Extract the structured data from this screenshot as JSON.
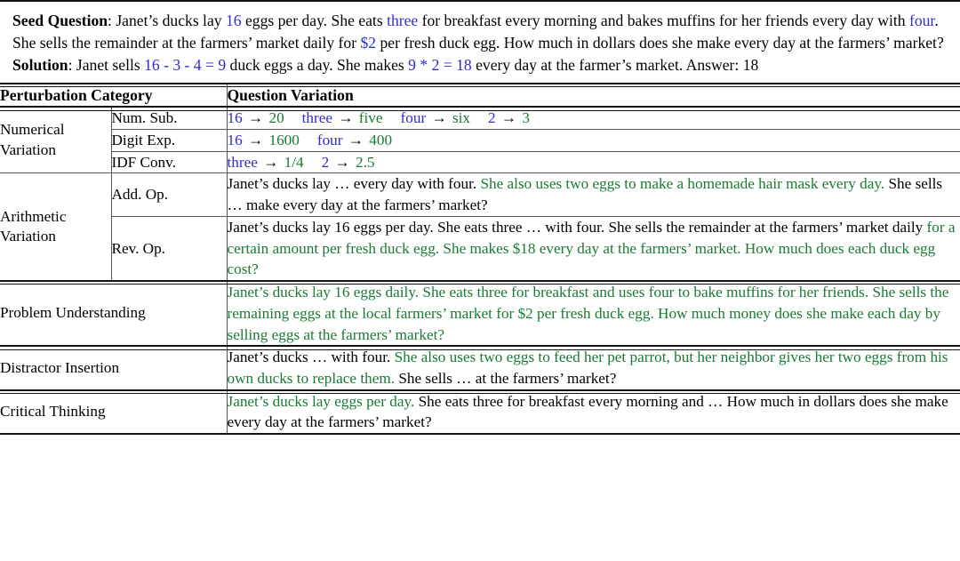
{
  "colors": {
    "blue": "#2d2dcf",
    "green": "#1a7a34",
    "text": "#000000",
    "rule": "#111111",
    "rule_light": "#555555"
  },
  "seed": {
    "question_label": "Seed Question",
    "question_parts": [
      {
        "t": ": Janet’s ducks lay ",
        "c": "black"
      },
      {
        "t": "16",
        "c": "blue"
      },
      {
        "t": " eggs per day. She eats ",
        "c": "black"
      },
      {
        "t": "three",
        "c": "blue"
      },
      {
        "t": " for breakfast every morning and bakes muffins for her friends every day with ",
        "c": "black"
      },
      {
        "t": "four",
        "c": "blue"
      },
      {
        "t": ". She sells the remainder at the farmers’ market daily for ",
        "c": "black"
      },
      {
        "t": "$2",
        "c": "blue"
      },
      {
        "t": " per fresh duck egg. How much in dollars does she make every day at the farmers’ market?",
        "c": "black"
      }
    ],
    "solution_label": "Solution",
    "solution_parts": [
      {
        "t": ": Janet sells ",
        "c": "black"
      },
      {
        "t": "16 - 3 - 4 = 9",
        "c": "blue"
      },
      {
        "t": " duck eggs a day. She makes ",
        "c": "black"
      },
      {
        "t": "9 * 2 = 18",
        "c": "blue"
      },
      {
        "t": " every day at the farmer’s market. Answer: 18",
        "c": "black"
      }
    ]
  },
  "table": {
    "header": {
      "category": "Perturbation Category",
      "variation": "Question Variation"
    },
    "groups": [
      {
        "name": "Numerical Variation",
        "name_line1": "Numerical",
        "name_line2": "Variation",
        "rows": [
          {
            "sub": "Num. Sub.",
            "mappings": [
              {
                "from": "16",
                "arrow": "→",
                "to": "20"
              },
              {
                "from": "three",
                "arrow": "→",
                "to": "five"
              },
              {
                "from": "four",
                "arrow": "→",
                "to": "six"
              },
              {
                "from": "2",
                "arrow": "→",
                "to": "3"
              }
            ]
          },
          {
            "sub": "Digit Exp.",
            "mappings": [
              {
                "from": "16",
                "arrow": "→",
                "to": "1600"
              },
              {
                "from": "four",
                "arrow": "→",
                "to": "400"
              }
            ]
          },
          {
            "sub": "IDF Conv.",
            "mappings": [
              {
                "from": "three",
                "arrow": "→",
                "to": "1/4"
              },
              {
                "from": "2",
                "arrow": "→",
                "to": "2.5"
              }
            ]
          }
        ]
      },
      {
        "name": "Arithmetic Variation",
        "name_line1": "Arithmetic",
        "name_line2": "Variation",
        "rows": [
          {
            "sub": "Add. Op.",
            "parts": [
              {
                "t": "Janet’s ducks lay … every day with four. ",
                "c": "black"
              },
              {
                "t": "She also uses two eggs to make a homemade hair mask every day.",
                "c": "green"
              },
              {
                "t": " She sells … make every day at the farmers’ market?",
                "c": "black"
              }
            ]
          },
          {
            "sub": "Rev. Op.",
            "parts": [
              {
                "t": "Janet’s ducks lay 16 eggs per day. She eats three … with four. She sells the remainder at the farmers’ market daily ",
                "c": "black"
              },
              {
                "t": "for a certain amount per fresh duck egg. She makes $18 every day at the farmers’ market. How much does each duck egg cost?",
                "c": "green"
              }
            ]
          }
        ]
      }
    ],
    "simple_rows": [
      {
        "name": "Problem Understanding",
        "parts": [
          {
            "t": "Janet’s ducks lay 16 eggs daily. She eats three for breakfast and uses four to bake muffins for her friends. She sells the remaining eggs at the local farmers’ market for $2 per fresh duck egg. How much money does she make each day by selling eggs at the farmers’ market?",
            "c": "green"
          }
        ]
      },
      {
        "name": "Distractor Insertion",
        "parts": [
          {
            "t": "Janet’s ducks … with four. ",
            "c": "black"
          },
          {
            "t": "She also uses two eggs to feed her pet parrot, but her neighbor gives her two eggs from his own ducks to replace them.",
            "c": "green"
          },
          {
            "t": " She sells … at the farmers’ market?",
            "c": "black"
          }
        ]
      },
      {
        "name": "Critical Thinking",
        "parts": [
          {
            "t": "Janet’s ducks lay eggs per day.",
            "c": "green"
          },
          {
            "t": " She eats three for breakfast every morning and … How much in dollars does she make every day at the farmers’ market?",
            "c": "black"
          }
        ]
      }
    ]
  }
}
